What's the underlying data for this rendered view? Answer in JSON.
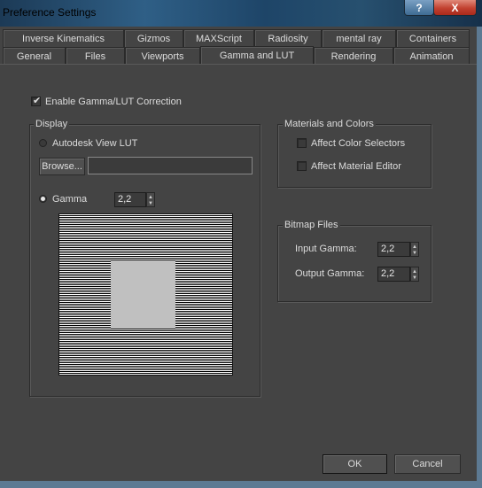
{
  "window": {
    "title": "Preference Settings",
    "help_glyph": "?",
    "close_glyph": "X"
  },
  "tabs": {
    "row1": [
      "Inverse Kinematics",
      "Gizmos",
      "MAXScript",
      "Radiosity",
      "mental ray",
      "Containers"
    ],
    "row2": [
      "General",
      "Files",
      "Viewports",
      "Gamma and LUT",
      "Rendering",
      "Animation"
    ],
    "active": "Gamma and LUT"
  },
  "enable_gamma": {
    "label": "Enable Gamma/LUT Correction",
    "checked": true
  },
  "display": {
    "legend": "Display",
    "lut_label": "Autodesk View LUT",
    "browse_label": "Browse...",
    "lut_path": "",
    "gamma_label": "Gamma",
    "gamma_value": "2,2"
  },
  "materials": {
    "legend": "Materials and Colors",
    "affect_color_selectors": "Affect Color Selectors",
    "affect_material_editor": "Affect Material Editor"
  },
  "bitmap": {
    "legend": "Bitmap Files",
    "input_label": "Input Gamma:",
    "input_value": "2,2",
    "output_label": "Output Gamma:",
    "output_value": "2,2"
  },
  "footer": {
    "ok": "OK",
    "cancel": "Cancel"
  },
  "icons": {
    "check": "check-icon",
    "up": "arrow-up-icon",
    "down": "arrow-down-icon"
  }
}
